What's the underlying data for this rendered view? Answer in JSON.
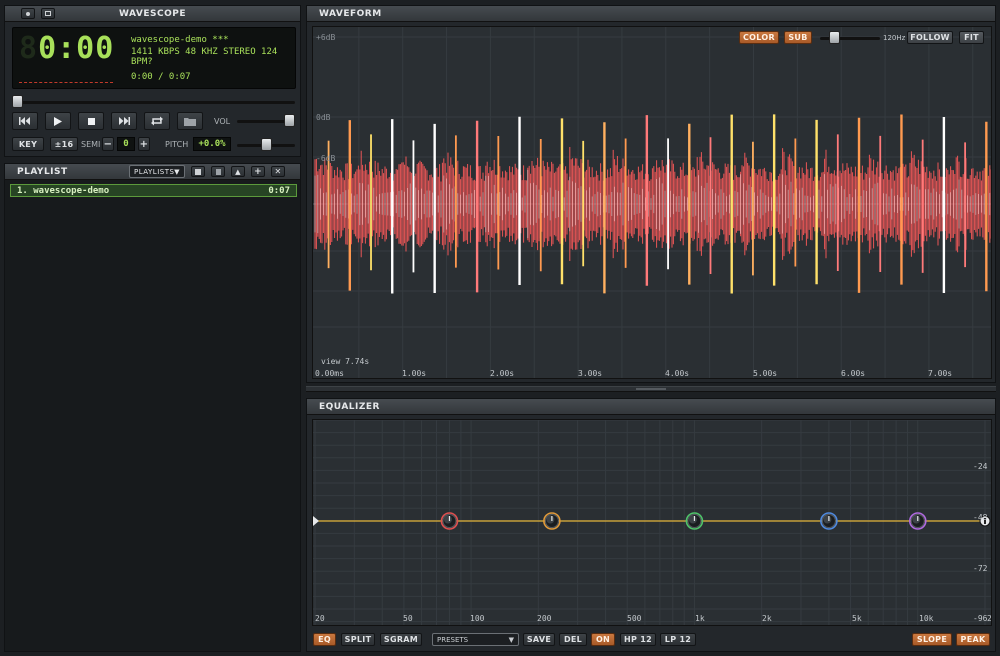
{
  "player": {
    "title": "WAVESCOPE",
    "time": "0:00",
    "track_name": "wavescope-demo ***",
    "format_info": "1411 KBPS  48 KHZ  STEREO  124 BPM?",
    "position": "0:00 / 0:07",
    "seek_fraction": 0.0,
    "vol_label": "VOL",
    "volume_fraction": 1.0,
    "key_label": "KEY",
    "range_label": "±16",
    "semi_label": "SEMI",
    "semi_value": "0",
    "minus_label": "−",
    "plus_label": "+",
    "pitch_label": "PITCH",
    "pitch_value": "+0.0%",
    "pitch_fraction": 0.5,
    "transport": [
      "prev-icon",
      "play-icon",
      "stop-icon",
      "next-icon",
      "repeat-icon",
      "folder-icon"
    ]
  },
  "playlist": {
    "title": "PLAYLIST",
    "dropdown": "PLAYLISTS",
    "items": [
      {
        "label": "1. wavescope-demo",
        "duration": "0:07"
      }
    ]
  },
  "waveform": {
    "title": "WAVEFORM",
    "color_btn": "COLOR",
    "sub_btn": "SUB",
    "freq_label": "120Hz",
    "follow_btn": "FOLLOW",
    "fit_btn": "FIT",
    "db_labels": [
      "+6dB",
      "0dB",
      "-6dB"
    ],
    "view_label": "view 7.74s",
    "time_labels": [
      "0.00ms",
      "1.00s",
      "2.00s",
      "3.00s",
      "4.00s",
      "5.00s",
      "6.00s",
      "7.00s"
    ],
    "wave_color": "#ff5a5a",
    "duration_s": 7.74,
    "beat_bpm": 124
  },
  "equalizer": {
    "title": "EQUALIZER",
    "db_labels": [
      "-24",
      "-48",
      "-72",
      "-96"
    ],
    "freq_labels": [
      "20",
      "50",
      "100",
      "200",
      "500",
      "1k",
      "2k",
      "5k",
      "10k"
    ],
    "bottom_right": "2",
    "bands": [
      {
        "freq_hz": 80,
        "gain_db": 0,
        "color": "#e05050"
      },
      {
        "freq_hz": 230,
        "gain_db": 0,
        "color": "#e09a3a"
      },
      {
        "freq_hz": 1000,
        "gain_db": 0,
        "color": "#4fc46a"
      },
      {
        "freq_hz": 4000,
        "gain_db": 0,
        "color": "#4f8ae0"
      },
      {
        "freq_hz": 10000,
        "gain_db": 0,
        "color": "#b06ae0"
      }
    ],
    "buttons": {
      "eq": "EQ",
      "split": "SPLIT",
      "sgram": "SGRAM",
      "presets": "PRESETS",
      "save": "SAVE",
      "del": "DEL",
      "on": "ON",
      "hp": "HP 12",
      "lp": "LP 12",
      "slope": "SLOPE",
      "peak": "PEAK"
    }
  }
}
